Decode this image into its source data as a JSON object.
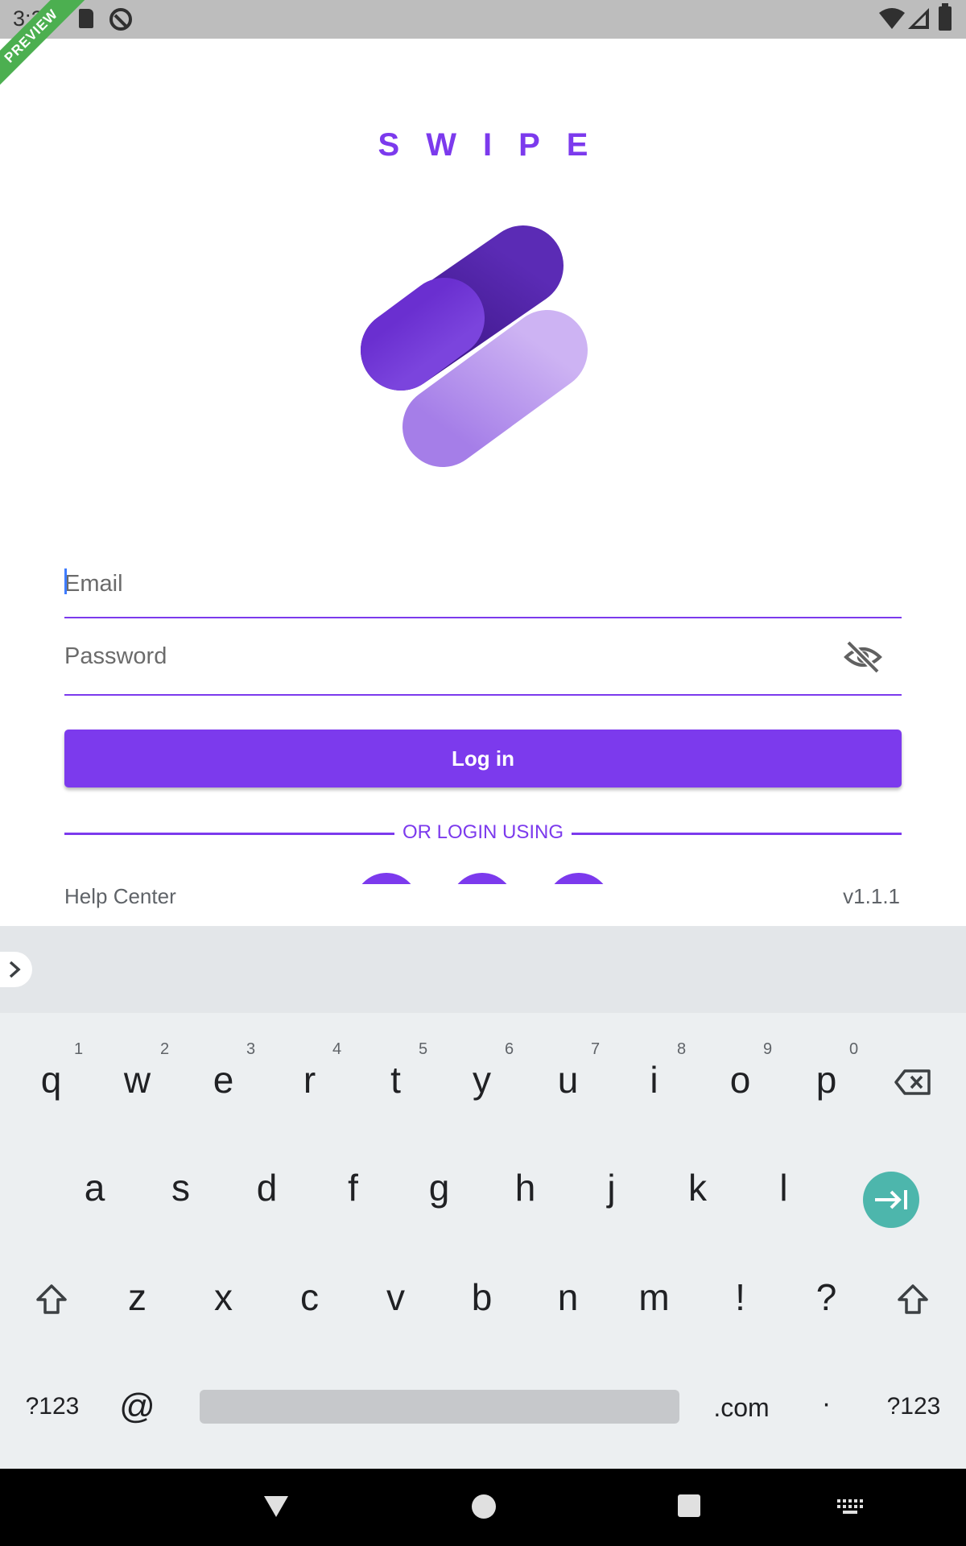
{
  "status_bar": {
    "time": "3:26",
    "icons": [
      "sd-card-icon",
      "sync-off-icon",
      "wifi-icon",
      "signal-icon",
      "battery-icon"
    ]
  },
  "ribbon": {
    "label": "PREVIEW",
    "color": "#4caf50"
  },
  "brand": {
    "title": "SWIPE",
    "color": "#7c3aed"
  },
  "form": {
    "email": {
      "placeholder": "Email",
      "value": ""
    },
    "password": {
      "placeholder": "Password",
      "value": "",
      "visibility_icon": "eye-off-icon"
    },
    "login_label": "Log in",
    "divider_label": "OR LOGIN USING"
  },
  "footer": {
    "help_label": "Help Center",
    "version": "v1.1.1"
  },
  "keyboard": {
    "row1": [
      {
        "key": "q",
        "hint": "1"
      },
      {
        "key": "w",
        "hint": "2"
      },
      {
        "key": "e",
        "hint": "3"
      },
      {
        "key": "r",
        "hint": "4"
      },
      {
        "key": "t",
        "hint": "5"
      },
      {
        "key": "y",
        "hint": "6"
      },
      {
        "key": "u",
        "hint": "7"
      },
      {
        "key": "i",
        "hint": "8"
      },
      {
        "key": "o",
        "hint": "9"
      },
      {
        "key": "p",
        "hint": "0"
      }
    ],
    "row2": [
      "a",
      "s",
      "d",
      "f",
      "g",
      "h",
      "j",
      "k",
      "l"
    ],
    "row3": [
      "z",
      "x",
      "c",
      "v",
      "b",
      "n",
      "m",
      "!",
      "?"
    ],
    "row4": {
      "symbols_left": "?123",
      "at": "@",
      "dotcom": ".com",
      "period": "·",
      "symbols_right": "?123"
    },
    "accent_color": "#4db6ac"
  },
  "nav_bar": {
    "icons": [
      "back-icon",
      "home-icon",
      "recents-icon",
      "keyboard-switch-icon"
    ]
  }
}
